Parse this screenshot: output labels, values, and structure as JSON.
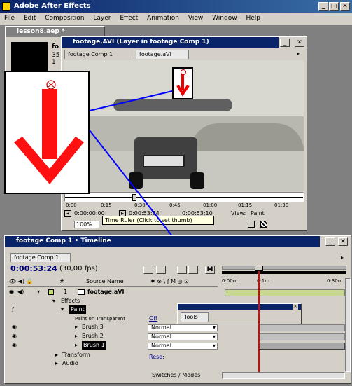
{
  "app": {
    "title": "Adobe After Effects"
  },
  "menu": [
    "File",
    "Edit",
    "Composition",
    "Layer",
    "Effect",
    "Animation",
    "View",
    "Window",
    "Help"
  ],
  "project": {
    "title": "lesson8.aep *",
    "name_fragment": "fo",
    "num_fragment": "35",
    "num_fragment2": "1"
  },
  "layer_window": {
    "title": "footage.AVI (Layer in footage Comp 1)",
    "tabs": [
      "footage Comp 1",
      "footage.aVI"
    ],
    "ruler_ticks": [
      "0:00",
      "0:15",
      "0:30",
      "0:45",
      "01:00",
      "01:15",
      "01:30"
    ],
    "tc_in": "0:00:00:00",
    "tc_out": "0:00:53:24",
    "tc_dur": "0:00:53:10",
    "view_label": "View:",
    "view_value": "Paint",
    "zoom": "100%",
    "tooltip": "Time Ruler (Click to set thumb)"
  },
  "timeline": {
    "title": "footage Comp 1 • Timeline",
    "tab": "footage Comp 1",
    "timecode": "0:00:53:24",
    "fps": "(30,00 fps)",
    "col_num": "#",
    "col_source": "Source Name",
    "ruler": [
      "0:00m",
      "0:1m",
      "0:30m"
    ],
    "layer_num": "1",
    "layer_name": "footage.aVI",
    "effects": "Effects",
    "paint": "Paint",
    "paint_transparent": "Paint on Transparent",
    "off": "Off",
    "brushes": [
      "Brush 3",
      "Brush 2",
      "Brush 1"
    ],
    "blend": [
      "Normal",
      "Normal",
      "Normal"
    ],
    "transform": "Transform",
    "audio": "Audio",
    "reset": "Rese:",
    "switches": "Switches / Modes"
  },
  "tools_panel": {
    "tab": "Tools"
  }
}
